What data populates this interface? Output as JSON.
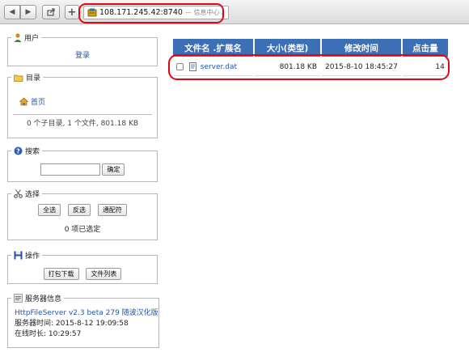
{
  "browser": {
    "address_url": "108.171.245.42:8740",
    "address_title": "— 信息中心 /"
  },
  "user_panel": {
    "legend": "用户",
    "login_link": "登录"
  },
  "dir_panel": {
    "legend": "目录",
    "home_link": "首页",
    "summary": "0 个子目录, 1 个文件, 801.18 KB"
  },
  "search_panel": {
    "legend": "搜索",
    "input_value": "",
    "confirm_button": "确定"
  },
  "select_panel": {
    "legend": "选择",
    "select_all_button": "全选",
    "invert_button": "反选",
    "wildcard_button": "通配符",
    "selected_count_text": "0 项已选定"
  },
  "action_panel": {
    "legend": "操作",
    "pack_download_button": "打包下载",
    "file_list_button": "文件列表"
  },
  "server_panel": {
    "legend": "服务器信息",
    "version_link": "HttpFileServer v2.3 beta 279 随波汉化版",
    "server_time": "服务器时间: 2015-8-12 19:09:58",
    "uptime": "在线时长: 10:29:57"
  },
  "file_table": {
    "headers": [
      "文件名 .扩展名",
      "大小(类型)",
      "修改时间",
      "点击量"
    ],
    "rows": [
      {
        "name": "server.dat",
        "size": "801.18 KB",
        "modified": "2015-8-10 18:45:27",
        "hits": "14"
      }
    ]
  },
  "colors": {
    "header_bg": "#3b6fb6",
    "highlight_oval": "#e30613",
    "link": "#2255aa"
  }
}
